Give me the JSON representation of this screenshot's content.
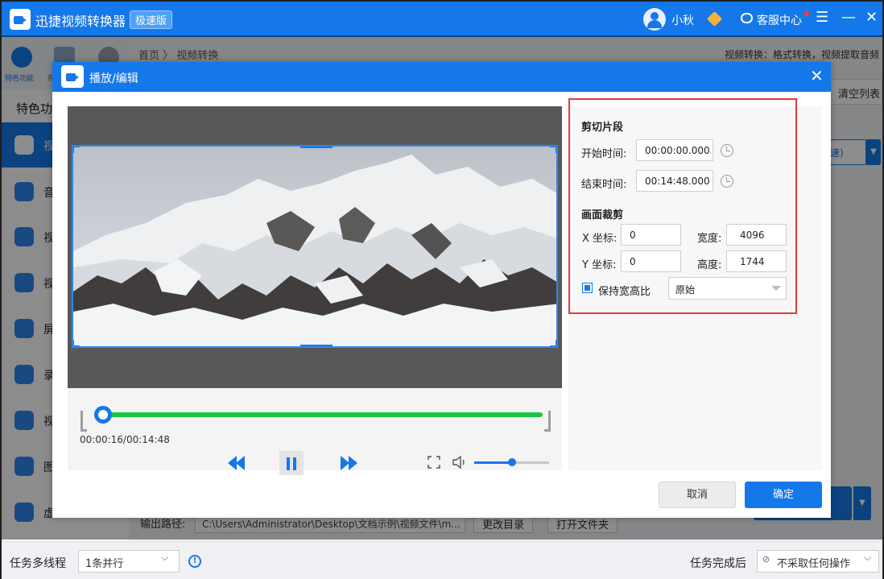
{
  "app": {
    "title": "迅捷视频转换器",
    "edition_badge": "极速版",
    "user_name": "小秋",
    "service_label": "客服中心",
    "menu_glyph": "☰",
    "minimize_glyph": "—",
    "close_glyph": "✕"
  },
  "sidebar": {
    "top_tabs": [
      {
        "label": "特色功能"
      },
      {
        "label": "视"
      }
    ],
    "heading": "特色功",
    "items": [
      {
        "label": "视",
        "icon": "video-icon",
        "active": true
      },
      {
        "label": "音",
        "icon": "audio-icon",
        "active": false
      },
      {
        "label": "视",
        "icon": "video-merge-icon",
        "active": false
      },
      {
        "label": "视",
        "icon": "video-translate-icon",
        "active": false
      },
      {
        "label": "屏",
        "icon": "screen-record-icon",
        "active": false
      },
      {
        "label": "录",
        "icon": "record-icon",
        "active": false
      },
      {
        "label": "视",
        "icon": "video-edit-icon",
        "active": false
      },
      {
        "label": "图",
        "icon": "image-icon",
        "active": false
      },
      {
        "label": "虚",
        "icon": "virtual-icon",
        "active": false
      }
    ]
  },
  "content": {
    "breadcrumb_home": "首页",
    "breadcrumb_sep": "〉",
    "breadcrumb_current": "视频转换",
    "description": "视频转换：格式转换，视频提取音频",
    "clear_list": "清空列表",
    "speed_label": "速)",
    "output_label": "输出路径:",
    "output_path": "C:\\Users\\Administrator\\Desktop\\文档示例\\视频文件\\m...",
    "change_dir": "更改目录",
    "open_folder": "打开文件夹"
  },
  "status": {
    "multithread_label": "任务多线程",
    "multithread_value": "1条并行",
    "after_done_label": "任务完成后",
    "after_done_value": "不采取任何操作"
  },
  "dialog": {
    "title": "播放/编辑",
    "close_glyph": "✕",
    "player": {
      "current_time": "00:00:16",
      "total_time": "00:14:48",
      "time_readout": "00:00:16/00:14:48",
      "progress": 0.018,
      "volume": 0.5
    },
    "cut": {
      "section_title": "剪切片段",
      "start_label": "开始时间:",
      "start_value": "00:00:00.000",
      "end_label": "结束时间:",
      "end_value": "00:14:48.000"
    },
    "crop": {
      "section_title": "画面裁剪",
      "x_label": "X 坐标:",
      "x_value": "0",
      "y_label": "Y 坐标:",
      "y_value": "0",
      "width_label": "宽度:",
      "width_value": "4096",
      "height_label": "高度:",
      "height_value": "1744",
      "keep_ratio_label": "保持宽高比",
      "keep_ratio_checked": true,
      "ratio_value": "原始"
    },
    "cancel_label": "取消",
    "ok_label": "确定"
  },
  "colors": {
    "primary": "#1478ea",
    "timeline_green": "#1ec543",
    "highlight_red": "#e23b3b"
  }
}
